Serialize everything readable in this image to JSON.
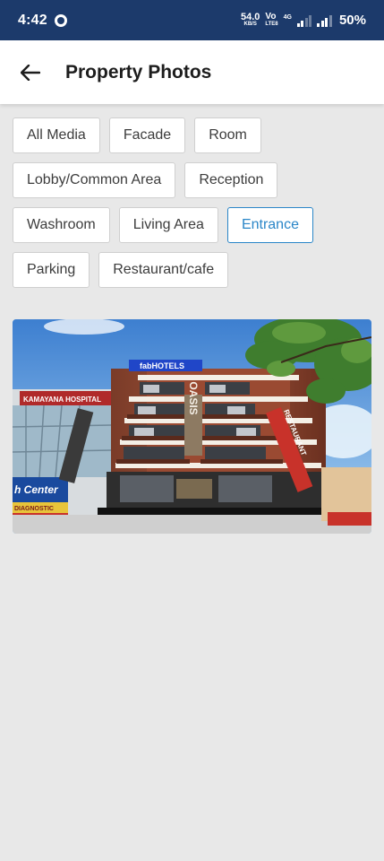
{
  "status_bar": {
    "time": "4:42",
    "net_speed": "54.0",
    "net_unit": "KB/S",
    "volte_top": "Vo",
    "volte_bottom": "LTE8",
    "network_tag": "4G",
    "battery": "50%"
  },
  "header": {
    "title": "Property Photos",
    "back_icon": "arrow-left-icon"
  },
  "filters": {
    "chips": [
      {
        "label": "All Media",
        "active": false
      },
      {
        "label": "Facade",
        "active": false
      },
      {
        "label": "Room",
        "active": false
      },
      {
        "label": "Lobby/Common Area",
        "active": false
      },
      {
        "label": "Reception",
        "active": false
      },
      {
        "label": "Washroom",
        "active": false
      },
      {
        "label": "Living Area",
        "active": false
      },
      {
        "label": "Entrance",
        "active": true
      },
      {
        "label": "Parking",
        "active": false
      },
      {
        "label": "Restaurant/cafe",
        "active": false
      }
    ]
  },
  "photo": {
    "signboard_brand": "fabHOTELS",
    "building_name": "OASIS",
    "left_sign": "KAMAYANA HOSPITAL",
    "left_banner": "h Center",
    "left_banner_sub": "DIAGNOSTIC",
    "right_sign": "RESTAURANT"
  },
  "colors": {
    "status_bar": "#1c3a6b",
    "accent": "#2a86c8",
    "background": "#e8e8e8"
  }
}
